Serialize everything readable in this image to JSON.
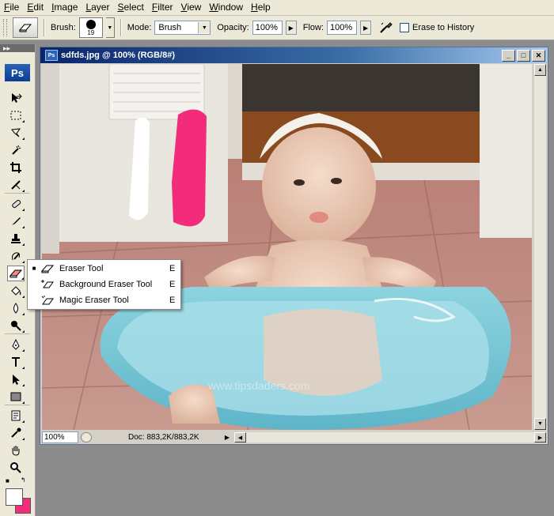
{
  "menubar": {
    "items": [
      {
        "label": "File",
        "mnemonic": "F",
        "rest": "ile"
      },
      {
        "label": "Edit",
        "mnemonic": "E",
        "rest": "dit"
      },
      {
        "label": "Image",
        "mnemonic": "I",
        "rest": "mage"
      },
      {
        "label": "Layer",
        "mnemonic": "L",
        "rest": "ayer"
      },
      {
        "label": "Select",
        "mnemonic": "S",
        "rest": "elect"
      },
      {
        "label": "Filter",
        "mnemonic": "F",
        "rest": "ilter"
      },
      {
        "label": "View",
        "mnemonic": "V",
        "rest": "iew"
      },
      {
        "label": "Window",
        "mnemonic": "W",
        "rest": "indow"
      },
      {
        "label": "Help",
        "mnemonic": "H",
        "rest": "elp"
      }
    ]
  },
  "options": {
    "brush_label": "Brush:",
    "brush_size": "19",
    "mode_label": "Mode:",
    "mode_value": "Brush",
    "opacity_label": "Opacity:",
    "opacity_value": "100%",
    "flow_label": "Flow:",
    "flow_value": "100%",
    "erase_history_label": "Erase to History"
  },
  "toolbox": {
    "logo": "Ps",
    "foreground_color": "#ffffff",
    "background_color": "#f22b7a"
  },
  "document": {
    "title": "sdfds.jpg @ 100% (RGB/8#)",
    "zoom": "100%",
    "doc_info": "Doc: 883,2K/883,2K",
    "watermark": "www.tipsdaders.com"
  },
  "context_menu": {
    "items": [
      {
        "label": "Eraser Tool",
        "shortcut": "E",
        "selected": true
      },
      {
        "label": "Background Eraser Tool",
        "shortcut": "E",
        "selected": false
      },
      {
        "label": "Magic Eraser Tool",
        "shortcut": "E",
        "selected": false
      }
    ]
  },
  "colors": {
    "titlebar_start": "#0a246a",
    "pink_stroke": "#f22b7a",
    "basin": "#7ec9d9"
  }
}
